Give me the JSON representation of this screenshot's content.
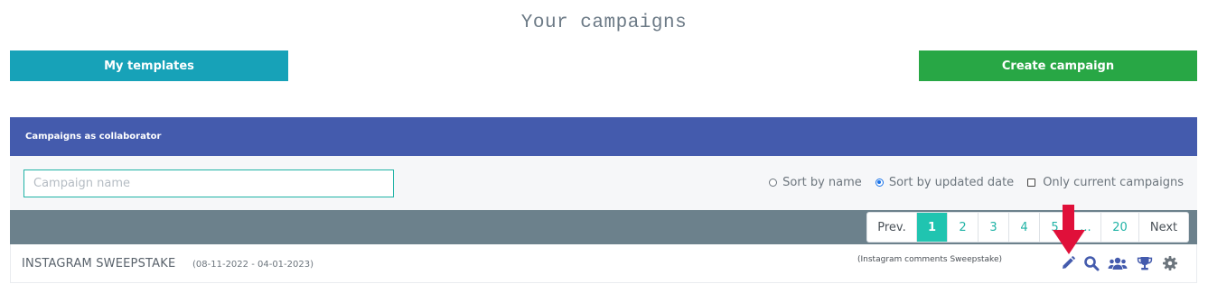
{
  "header": {
    "title": "Your campaigns"
  },
  "actions": {
    "templates_label": "My templates",
    "create_label": "Create campaign"
  },
  "panel": {
    "title": "Campaigns as collaborator"
  },
  "filters": {
    "search_placeholder": "Campaign name",
    "search_value": "",
    "sort_by_name": "Sort by name",
    "sort_by_updated": "Sort by updated date",
    "selected_sort": "Sort by updated date",
    "only_current": "Only current campaigns",
    "only_current_checked": false
  },
  "pagination": {
    "prev": "Prev.",
    "pages": [
      "1",
      "2",
      "3",
      "4",
      "5",
      "...",
      "20"
    ],
    "current": "1",
    "next": "Next"
  },
  "campaigns": [
    {
      "name": "INSTAGRAM SWEEPSTAKE",
      "dates": "(08-11-2022 - 04-01-2023)",
      "type": "(Instagram comments Sweepstake)",
      "actions": [
        "pencil-icon",
        "search-icon",
        "users-icon",
        "trophy-icon",
        "gear-icon"
      ]
    }
  ],
  "colors": {
    "templates_button": "#17a2b8",
    "create_button": "#28a745",
    "panel_header": "#445bad",
    "pager_bar": "#6c818c",
    "active_page": "#20c4b0",
    "action_icons": "#445bad",
    "arrow": "#e0103a"
  }
}
